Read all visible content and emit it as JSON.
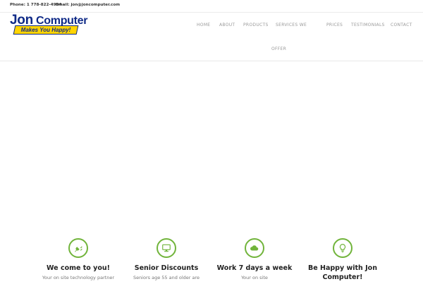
{
  "topbar": {
    "phone": "Phone: 1 778-822-4994",
    "email": "Email: jon@joncomputer.com"
  },
  "logo": {
    "name_first": "Jon",
    "name_second": "Computer",
    "tagline": "Makes You Happy!"
  },
  "nav": {
    "items": [
      {
        "label": "HOME"
      },
      {
        "label": "ABOUT"
      },
      {
        "label": "PRODUCTS"
      },
      {
        "label": "SERVICES WE"
      },
      {
        "label": "OFFER"
      },
      {
        "label": "PRICES"
      },
      {
        "label": "TESTIMONIALS"
      },
      {
        "label": "CONTACT"
      }
    ]
  },
  "features": [
    {
      "icon": "plug-icon",
      "title": "We come to you!",
      "text": "Your on site technology partner"
    },
    {
      "icon": "monitor-icon",
      "title": "Senior Discounts",
      "text": "Seniors age 55 and older are"
    },
    {
      "icon": "cloud-icon",
      "title": "Work 7 days a week",
      "text": "Your on site"
    },
    {
      "icon": "lightbulb-icon",
      "title": "Be Happy with Jon Computer!",
      "text": ""
    }
  ],
  "colors": {
    "accent": "#71b43b",
    "brand_blue": "#0f2a87",
    "brand_yellow": "#ffd400"
  }
}
